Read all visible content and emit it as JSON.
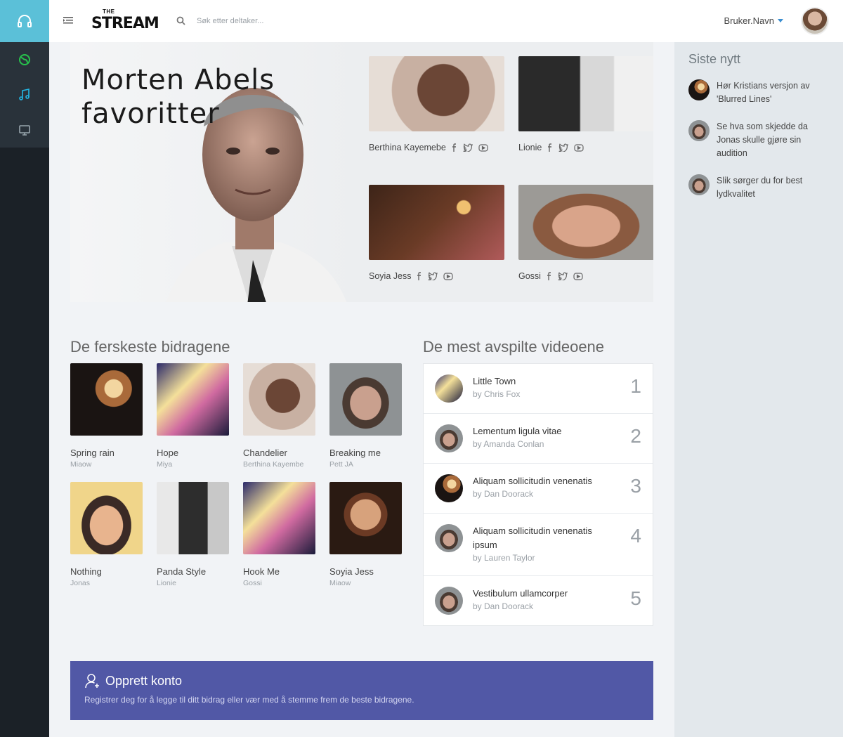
{
  "header": {
    "brand_top": "THE",
    "brand_main": "STREAM",
    "search_placeholder": "Søk etter deltaker...",
    "user_name": "Bruker.Navn"
  },
  "nav": {
    "icons": [
      "headphones-icon",
      "globe-icon",
      "music-note-icon",
      "monitor-icon"
    ],
    "colors": {
      "logo_bg": "#5bc0d8",
      "globe": "#27c24c",
      "music": "#23b7e5",
      "monitor": "#98a6ad"
    }
  },
  "hero": {
    "title_line1": "Morten Abels",
    "title_line2": "favoritter",
    "cards": [
      {
        "name": "Berthina Kayemebe"
      },
      {
        "name": "Lionie"
      },
      {
        "name": "Soyia Jess"
      },
      {
        "name": "Gossi"
      }
    ]
  },
  "latest": {
    "title": "De ferskeste bidragene",
    "items": [
      {
        "title": "Spring rain",
        "artist": "Miaow"
      },
      {
        "title": "Hope",
        "artist": "Miya"
      },
      {
        "title": "Chandelier",
        "artist": "Berthina Kayembe"
      },
      {
        "title": "Breaking me",
        "artist": "Pett JA"
      },
      {
        "title": "Nothing",
        "artist": "Jonas"
      },
      {
        "title": "Panda Style",
        "artist": "Lionie"
      },
      {
        "title": "Hook Me",
        "artist": "Gossi"
      },
      {
        "title": "Soyia Jess",
        "artist": "Miaow"
      }
    ]
  },
  "most_played": {
    "title": "De mest avspilte videoene",
    "items": [
      {
        "rank": "1",
        "title": "Little Town",
        "by": "by Chris Fox"
      },
      {
        "rank": "2",
        "title": "Lementum ligula vitae",
        "by": "by Amanda Conlan"
      },
      {
        "rank": "3",
        "title": "Aliquam sollicitudin venenatis",
        "by": "by Dan Doorack"
      },
      {
        "rank": "4",
        "title": "Aliquam sollicitudin venenatis ipsum",
        "by": "by Lauren Taylor"
      },
      {
        "rank": "5",
        "title": "Vestibulum ullamcorper",
        "by": "by Dan Doorack"
      }
    ]
  },
  "news": {
    "title": "Siste nytt",
    "items": [
      {
        "text": "Hør Kristians versjon av 'Blurred Lines'"
      },
      {
        "text": "Se hva som skjedde da Jonas skulle gjøre sin audition"
      },
      {
        "text": "Slik sørger du for best lydkvalitet"
      }
    ]
  },
  "cta": {
    "title": "Opprett konto",
    "text": "Registrer deg for å legge til ditt bidrag eller vær med å stemme frem de beste bidragene.",
    "bg_color": "#5158a6"
  }
}
